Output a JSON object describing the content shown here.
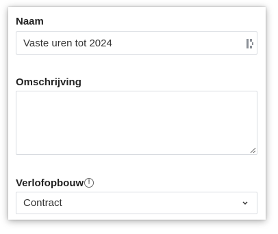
{
  "form": {
    "name_label": "Naam",
    "name_value": "Vaste uren tot 2024",
    "description_label": "Omschrijving",
    "description_value": "",
    "accrual_label": "Verlofopbouw",
    "accrual_info_glyph": "!",
    "accrual_value": "Contract"
  },
  "icons": {
    "name_field_icon": "password-manager-icon",
    "description_resize": "resize-handle-icon",
    "accrual_info": "info-icon",
    "accrual_dropdown": "chevron-down-icon"
  },
  "colors": {
    "border": "#d8dbe0",
    "label_text": "#222222",
    "field_text": "#333333"
  }
}
